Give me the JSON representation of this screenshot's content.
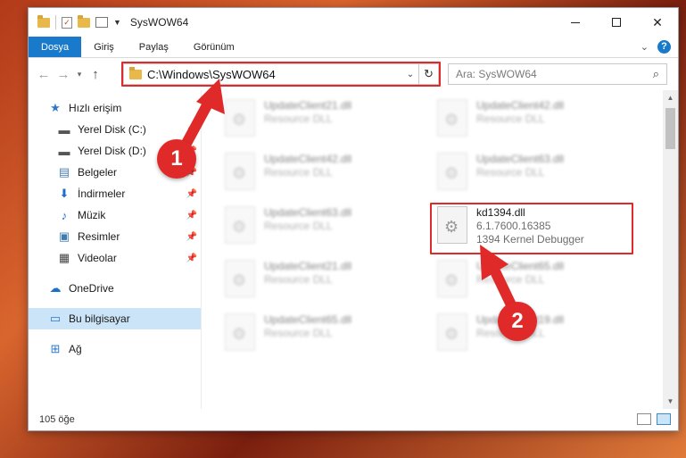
{
  "window": {
    "title": "SysWOW64"
  },
  "ribbon": {
    "tabs": [
      "Dosya",
      "Giriş",
      "Paylaş",
      "Görünüm"
    ]
  },
  "address": {
    "path": "C:\\Windows\\SysWOW64"
  },
  "search": {
    "placeholder": "Ara: SysWOW64"
  },
  "sidebar": {
    "items": [
      {
        "label": "Hızlı erişim",
        "icon": "star-icon",
        "pinned": false
      },
      {
        "label": "Yerel Disk (C:)",
        "icon": "drive-icon",
        "pinned": true
      },
      {
        "label": "Yerel Disk (D:)",
        "icon": "drive-icon",
        "pinned": true
      },
      {
        "label": "Belgeler",
        "icon": "documents-icon",
        "pinned": true
      },
      {
        "label": "İndirmeler",
        "icon": "download-icon",
        "pinned": true
      },
      {
        "label": "Müzik",
        "icon": "music-icon",
        "pinned": true
      },
      {
        "label": "Resimler",
        "icon": "pictures-icon",
        "pinned": true
      },
      {
        "label": "Videolar",
        "icon": "videos-icon",
        "pinned": true
      },
      {
        "label": "OneDrive",
        "icon": "cloud-icon",
        "pinned": false
      },
      {
        "label": "Bu bilgisayar",
        "icon": "computer-icon",
        "pinned": false,
        "selected": true
      },
      {
        "label": "Ağ",
        "icon": "network-icon",
        "pinned": false
      }
    ]
  },
  "files": [
    {
      "name": "UpdateClient21.dll",
      "sub": "Resource DLL",
      "blurred": true
    },
    {
      "name": "UpdateClient42.dll",
      "sub": "Resource DLL",
      "blurred": true
    },
    {
      "name": "UpdateClient42.dll",
      "sub": "Resource DLL",
      "blurred": true
    },
    {
      "name": "UpdateClient63.dll",
      "sub": "Resource DLL",
      "blurred": true
    },
    {
      "name": "UpdateClient63.dll",
      "sub": "Resource DLL",
      "blurred": true
    },
    {
      "name": "kd1394.dll",
      "version": "6.1.7600.16385",
      "sub": "1394 Kernel Debugger",
      "blurred": false
    },
    {
      "name": "UpdateClient21.dll",
      "sub": "Resource DLL",
      "blurred": true
    },
    {
      "name": "UpdateClient65.dll",
      "sub": "Resource DLL",
      "blurred": true
    },
    {
      "name": "UpdateClient65.dll",
      "sub": "Resource DLL",
      "blurred": true
    },
    {
      "name": "UpdateClient19.dll",
      "sub": "Resource DLL",
      "blurred": true
    }
  ],
  "status": {
    "count": "105 öğe"
  },
  "annotations": {
    "step1": "1",
    "step2": "2",
    "color": "#e02a2a"
  }
}
